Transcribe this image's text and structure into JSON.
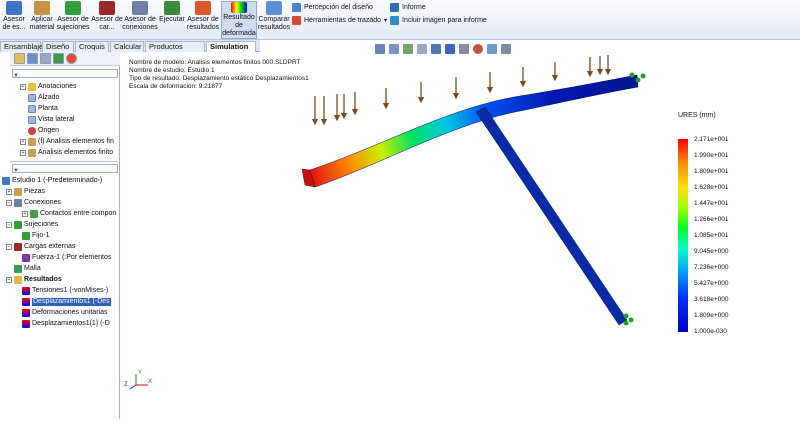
{
  "ribbon": {
    "buttons": [
      {
        "id": "asesor_estudio",
        "label": "Asesor de es..."
      },
      {
        "id": "aplicar_material",
        "label": "Aplicar material"
      },
      {
        "id": "asesor_sujeciones",
        "label": "Asesor de sujeciones"
      },
      {
        "id": "asesor_cargas",
        "label": "Asesor de car..."
      },
      {
        "id": "asesor_conexiones",
        "label": "Asesor de conexiones"
      },
      {
        "id": "ejecutar",
        "label": "Ejecutar"
      },
      {
        "id": "asesor_resultados",
        "label": "Asesor de resultados"
      },
      {
        "id": "resultado_deformada",
        "label": "Resultado de deformada"
      },
      {
        "id": "comparar_resultados",
        "label": "Comparar resultados"
      }
    ],
    "small": {
      "percepcion": "Percepción del diseño",
      "herramientas": "Herramientas de trazado",
      "informe": "Informe",
      "incluir": "Incluir imagen para informe"
    }
  },
  "tabs": [
    "Ensamblaje",
    "Diseño",
    "Croquis",
    "Calcular",
    "Productos Office",
    "Simulation"
  ],
  "tree_top": {
    "filter": "",
    "items": [
      "Anotaciones",
      "Alzado",
      "Planta",
      "Vista lateral",
      "Origen",
      "(f) Analisis elementos fin",
      "Analisis elementos finito"
    ]
  },
  "tree_bottom": {
    "filter": "",
    "items": [
      "Estudio 1 (-Predeterminado-)",
      "Piezas",
      "Conexiones",
      "Contactos entre compon",
      "Sujeciones",
      "Fijo-1",
      "Cargas externas",
      "Fuerza-1 (:Por elementos",
      "Malla",
      "Resultados",
      "Tensiones1 (-vonMises-)",
      "Desplazamientos1 (-Des",
      "Deformaciones unitarias",
      "Desplazamientos1{1} (-D"
    ]
  },
  "info": {
    "line1": "Nombre de modelo: Analisis elementos finitos 000.SLDPRT",
    "line2": "Nombre de estudio: Estudio 1",
    "line3": "Tipo de resultado: Desplazamiento estático Desplazamientos1",
    "line4": "Escala de deformación: 9.21877"
  },
  "legend": {
    "title": "URES (mm)",
    "values": [
      "2.171e+001",
      "1.990e+001",
      "1.809e+001",
      "1.628e+001",
      "1.447e+001",
      "1.266e+001",
      "1.085e+001",
      "9.045e+000",
      "7.236e+000",
      "5.427e+000",
      "3.618e+000",
      "1.809e+000",
      "1.000e-030"
    ]
  },
  "colors": {
    "max": "#ff0000",
    "min": "#0000c8",
    "load_arrow": "#7a4a1c",
    "fixture": "#1f9e2b"
  },
  "triad": {
    "x": "X",
    "y": "Y",
    "z": "Z"
  }
}
